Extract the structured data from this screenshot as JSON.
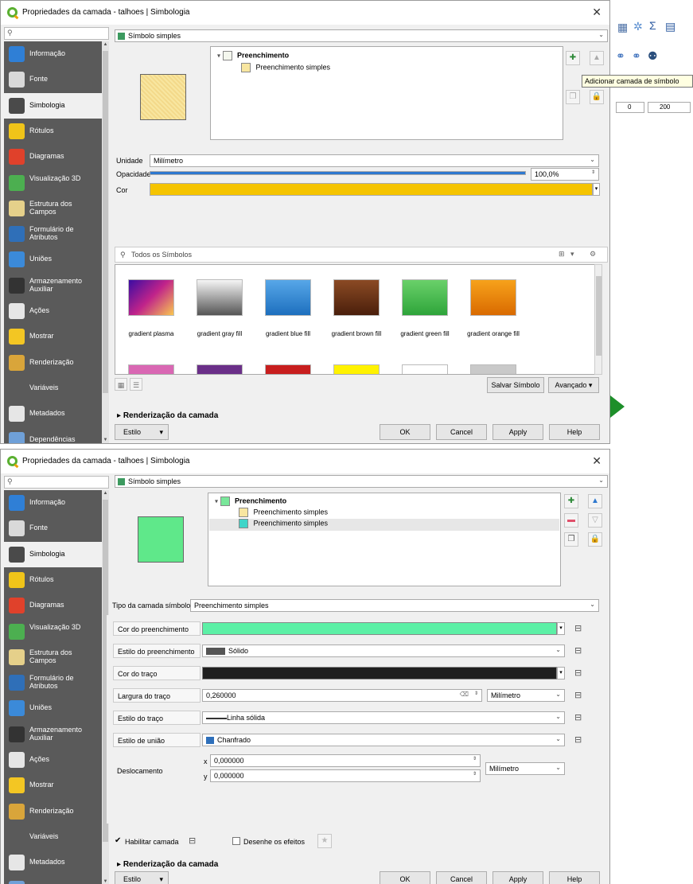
{
  "window1": {
    "title": "Propriedades da camada - talhoes | Simbologia",
    "sidebar": [
      {
        "label": "Informação",
        "color": "#2f7fd6",
        "icon": "info-icon"
      },
      {
        "label": "Fonte",
        "color": "#d9d9d9",
        "icon": "source-icon"
      },
      {
        "label": "Simbologia",
        "color": "#4a4a4a",
        "icon": "symbology-icon"
      },
      {
        "label": "Rótulos",
        "color": "#f0c419",
        "icon": "labels-icon"
      },
      {
        "label": "Diagramas",
        "color": "#e0412b",
        "icon": "diagrams-icon"
      },
      {
        "label": "Visualização 3D",
        "color": "#4caf50",
        "icon": "3d-icon"
      },
      {
        "label": "Estrutura dos Campos",
        "color": "#e5d08a",
        "icon": "fields-icon"
      },
      {
        "label": "Formulário de Atributos",
        "color": "#2f6fb8",
        "icon": "form-icon"
      },
      {
        "label": "Uniões",
        "color": "#3b8ad9",
        "icon": "joins-icon"
      },
      {
        "label": "Armazenamento Auxiliar",
        "color": "#333333",
        "icon": "storage-icon"
      },
      {
        "label": "Ações",
        "color": "#e6e6e6",
        "icon": "actions-icon"
      },
      {
        "label": "Mostrar",
        "color": "#f3c623",
        "icon": "display-icon"
      },
      {
        "label": "Renderização",
        "color": "#d9a53a",
        "icon": "rendering-icon"
      },
      {
        "label": "Variáveis",
        "color": "#5a5a5a",
        "icon": "variables-icon"
      },
      {
        "label": "Metadados",
        "color": "#e6e6e6",
        "icon": "metadata-icon"
      },
      {
        "label": "Dependências",
        "color": "#6fa0d8",
        "icon": "dependencies-icon"
      }
    ],
    "symbol_type": "Símbolo simples",
    "tree": {
      "root": "Preenchimento",
      "child": "Preenchimento simples"
    },
    "tooltip": "Adicionar camada de símbolo",
    "unit_label": "Unidade",
    "unit_value": "Milímetro",
    "opacity_label": "Opacidade",
    "opacity_value": "100,0%",
    "opacity_fraction": 1.0,
    "color_label": "Cor",
    "color_value": "#f5c400",
    "library_search": "Todos os Símbolos",
    "symbols": [
      {
        "name": "gradient plasma"
      },
      {
        "name": "gradient gray fill"
      },
      {
        "name": "gradient blue fill"
      },
      {
        "name": "gradient brown fill"
      },
      {
        "name": "gradient green fill"
      },
      {
        "name": "gradient orange fill"
      }
    ],
    "save_symbol": "Salvar Símbolo",
    "advanced": "Avançado",
    "rendering_section": "Renderização da camada",
    "style": "Estilo",
    "ok": "OK",
    "cancel": "Cancel",
    "apply": "Apply",
    "help": "Help"
  },
  "right_toolbar": {
    "spin1": "0",
    "spin2": "200",
    "sigma": "Σ"
  },
  "window2": {
    "title": "Propriedades da camada - talhoes | Simbologia",
    "symbol_type": "Símbolo simples",
    "tree": {
      "root": "Preenchimento",
      "child1": "Preenchimento simples",
      "child2": "Preenchimento simples"
    },
    "layer_type_label": "Tipo da camada símbolo",
    "layer_type_value": "Preenchimento simples",
    "fill_color_label": "Cor do preenchimento",
    "fill_color": "#5cf0a6",
    "fill_style_label": "Estilo do preenchimento",
    "fill_style_value": "Sólido",
    "stroke_color_label": "Cor do traço",
    "stroke_color": "#1f1f1f",
    "stroke_width_label": "Largura do traço",
    "stroke_width_value": "0,260000",
    "stroke_width_unit": "Milímetro",
    "stroke_style_label": "Estilo do traço",
    "stroke_style_value": "Linha sólida",
    "join_style_label": "Estilo de união",
    "join_style_value": "Chanfrado",
    "offset_label": "Deslocamento",
    "offset_x_label": "x",
    "offset_x": "0,000000",
    "offset_y_label": "y",
    "offset_y": "0,000000",
    "offset_unit": "Milímetro",
    "enable_layer": "Habilitar camada",
    "draw_effects": "Desenhe os efeitos",
    "rendering_section": "Renderização da camada",
    "style": "Estilo",
    "ok": "OK",
    "cancel": "Cancel",
    "apply": "Apply",
    "help": "Help"
  }
}
